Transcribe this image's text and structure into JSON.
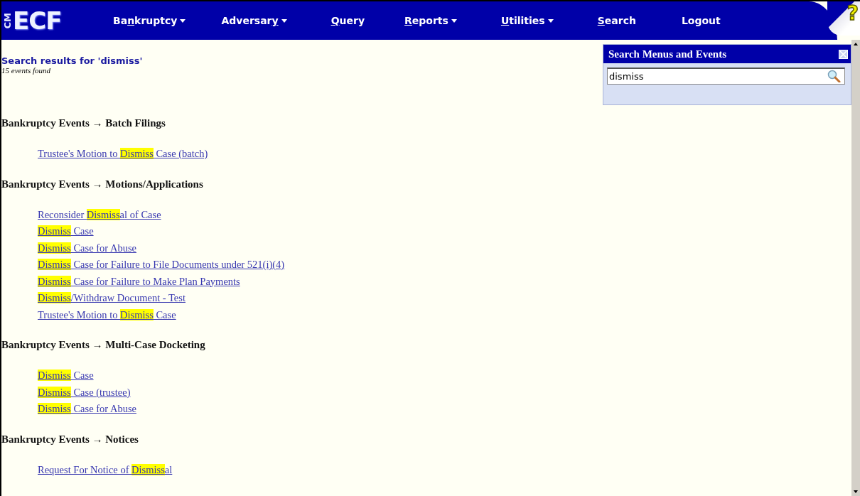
{
  "logo": {
    "small": "CM",
    "big": "ECF"
  },
  "menu": [
    {
      "pre": "Ba",
      "key": "n",
      "post": "kruptcy",
      "dropdown": true
    },
    {
      "pre": "Adversar",
      "key": "y",
      "dropdown": true
    },
    {
      "key": "Q",
      "post": "uery",
      "dropdown": false
    },
    {
      "key": "R",
      "post": "eports",
      "dropdown": true
    },
    {
      "key": "U",
      "post": "tilities",
      "dropdown": true
    },
    {
      "key": "S",
      "post": "earch",
      "dropdown": false
    },
    {
      "pre": "Logout",
      "dropdown": false
    }
  ],
  "help": {
    "label": "?"
  },
  "results": {
    "title": "Search results for 'dismiss'",
    "count": "15 events found"
  },
  "groups": [
    {
      "heading": "Bankruptcy Events → Batch Filings",
      "links": [
        {
          "before": "Trustee's Motion to ",
          "match": "Dismiss",
          "after": " Case (batch)"
        }
      ]
    },
    {
      "heading": "Bankruptcy Events → Motions/Applications",
      "links": [
        {
          "before": "Reconsider ",
          "match": "Dismiss",
          "after": "al of Case"
        },
        {
          "match": "Dismiss",
          "after": " Case"
        },
        {
          "match": "Dismiss",
          "after": " Case for Abuse"
        },
        {
          "match": "Dismiss",
          "after": " Case for Failure to File Documents under 521(i)(4)"
        },
        {
          "match": "Dismiss",
          "after": " Case for Failure to Make Plan Payments"
        },
        {
          "match": "Dismiss",
          "after": "/Withdraw Document - Test"
        },
        {
          "before": "Trustee's Motion to ",
          "match": "Dismiss",
          "after": " Case"
        }
      ]
    },
    {
      "heading": "Bankruptcy Events → Multi-Case Docketing",
      "links": [
        {
          "match": "Dismiss",
          "after": " Case"
        },
        {
          "match": "Dismiss",
          "after": " Case (trustee)"
        },
        {
          "match": "Dismiss",
          "after": " Case for Abuse"
        }
      ]
    },
    {
      "heading": "Bankruptcy Events → Notices",
      "links": [
        {
          "before": "Request For Notice of ",
          "match": "Dismiss",
          "after": "al"
        }
      ]
    }
  ],
  "search_panel": {
    "title": "Search Menus and Events",
    "value": "dismiss"
  }
}
